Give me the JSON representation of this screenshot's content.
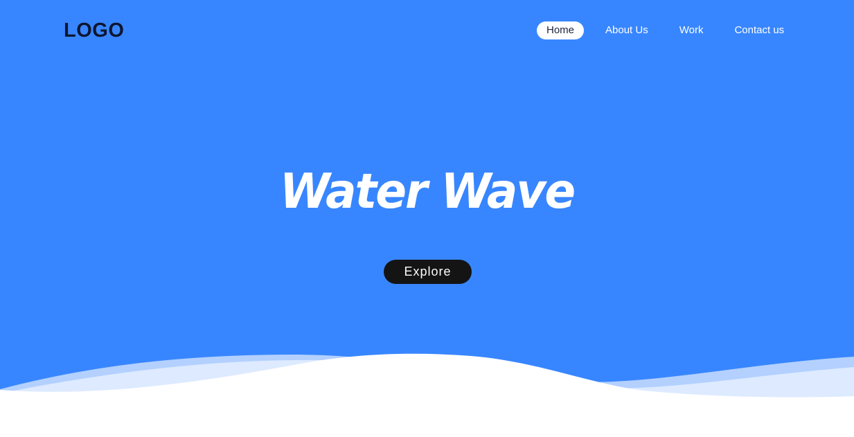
{
  "header": {
    "logo": "LOGO"
  },
  "nav": {
    "items": [
      {
        "label": "Home",
        "active": true
      },
      {
        "label": "About Us",
        "active": false
      },
      {
        "label": "Work",
        "active": false
      },
      {
        "label": "Contact us",
        "active": false
      }
    ]
  },
  "hero": {
    "title": "Water Wave",
    "cta_label": "Explore"
  },
  "colors": {
    "background": "#3886ff",
    "button": "#141414",
    "wave_front": "#ffffff",
    "wave_back": "#c9ddff"
  }
}
